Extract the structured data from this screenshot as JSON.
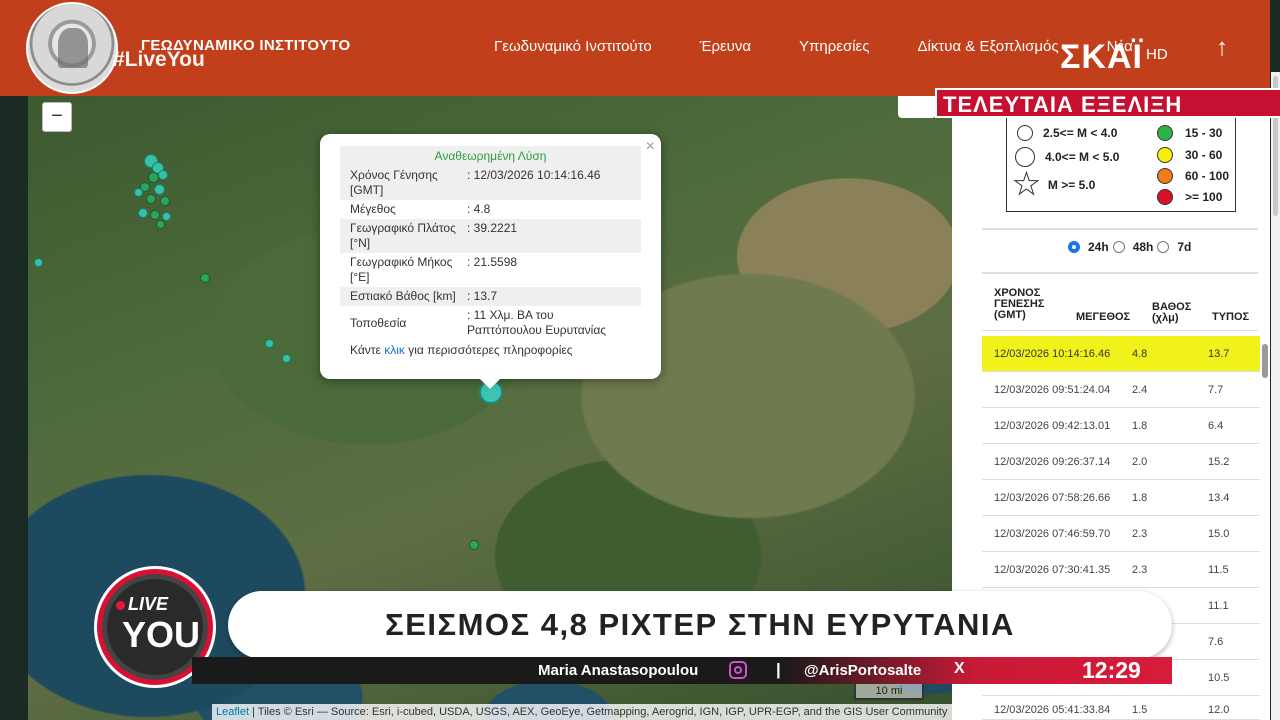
{
  "header": {
    "institute_name": "ΓΕΩΔΥΝΑΜΙΚΟ ΙΝΣΤΙΤΟΥΤΟ",
    "hashtag": "#LiveYou",
    "nav": [
      "Γεωδυναμικό Ινστιτούτο",
      "Έρευνα",
      "Υπηρεσίες",
      "Δίκτυα & Εξοπλισμός",
      "Νέα"
    ],
    "channel_logo": "ΣΚΑΪ",
    "channel_hd": "HD",
    "up_icon": "arrow-up-icon"
  },
  "breaking_banner": "ΤΕΛΕΥΤΑΙΑ ΕΞΕΛΙΞΗ",
  "map": {
    "zoom_out_label": "−",
    "scale_label": "10 mi",
    "attribution_leaflet": "Leaflet",
    "attribution_rest": " | Tiles © Esri — Source: Esri, i-cubed, USDA, USGS, AEX, GeoEye, Getmapping, Aerogrid, IGN, IGP, UPR-EGP, and the GIS User Community"
  },
  "popup": {
    "close": "×",
    "title": "Αναθεωρημένη Λύση",
    "rows": [
      {
        "label": "Χρόνος Γένησης [GMT]",
        "value": ": 12/03/2026 10:14:16.46"
      },
      {
        "label": "Μέγεθος",
        "value": ": 4.8"
      },
      {
        "label": "Γεωγραφικό Πλάτος [°N]",
        "value": ": 39.2221"
      },
      {
        "label": "Γεωγραφικό Μήκος [°E]",
        "value": ": 21.5598"
      },
      {
        "label": "Εστιακό Βάθος [km]",
        "value": ": 13.7"
      },
      {
        "label": "Τοποθεσία",
        "value": ": 11 Χλμ. ΒΑ του Ραπτόπουλου Ευρυτανίας"
      }
    ],
    "footer_pre": "Κάντε ",
    "footer_link": "κλικ",
    "footer_post": " για περισσότερες πληροφορίες"
  },
  "legend": {
    "magnitudes": [
      "2.5<= M < 4.0",
      "4.0<= M < 5.0",
      "M >= 5.0"
    ],
    "depths": [
      {
        "label": "15 - 30",
        "color": "#2db24a"
      },
      {
        "label": "30 - 60",
        "color": "#f5f010"
      },
      {
        "label": "60 - 100",
        "color": "#f07d1a"
      },
      {
        "label": ">= 100",
        "color": "#d8102a"
      }
    ]
  },
  "time_filter": {
    "options": [
      "24h",
      "48h",
      "7d"
    ],
    "selected": "24h"
  },
  "table": {
    "headers": {
      "time": "ΧΡΟΝΟΣ ΓΕΝΕΣΗΣ (GMT)",
      "magnitude": "ΜΕΓΕΘΟΣ",
      "depth": "ΒΑΘΟΣ (χλμ)",
      "type": "ΤΥΠΟΣ"
    },
    "rows": [
      {
        "time": "12/03/2026 10:14:16.46",
        "mag": "4.8",
        "depth": "13.7",
        "highlight": true
      },
      {
        "time": "12/03/2026 09:51:24.04",
        "mag": "2.4",
        "depth": "7.7"
      },
      {
        "time": "12/03/2026 09:42:13.01",
        "mag": "1.8",
        "depth": "6.4"
      },
      {
        "time": "12/03/2026 09:26:37.14",
        "mag": "2.0",
        "depth": "15.2"
      },
      {
        "time": "12/03/2026 07:58:26.66",
        "mag": "1.8",
        "depth": "13.4"
      },
      {
        "time": "12/03/2026 07:46:59.70",
        "mag": "2.3",
        "depth": "15.0"
      },
      {
        "time": "12/03/2026 07:30:41.35",
        "mag": "2.3",
        "depth": "11.5"
      },
      {
        "time": "",
        "mag": "",
        "depth": "11.1"
      },
      {
        "time": "",
        "mag": "",
        "depth": "7.6"
      },
      {
        "time": "",
        "mag": "",
        "depth": "10.5"
      },
      {
        "time": "12/03/2026 05:41:33.84",
        "mag": "1.5",
        "depth": "12.0"
      }
    ]
  },
  "lower_third": {
    "show_live": "LIVE",
    "show_you": "YOU",
    "headline": "ΣΕΙΣΜΟΣ 4,8 ΡΙΧΤΕΡ ΣΤΗΝ ΕΥΡΥΤΑΝΙΑ",
    "presenter": "Maria Anastasopoulou",
    "separator": "|",
    "handle": "@ArisPortosalte",
    "x_icon": "X",
    "clock": "12:29"
  }
}
